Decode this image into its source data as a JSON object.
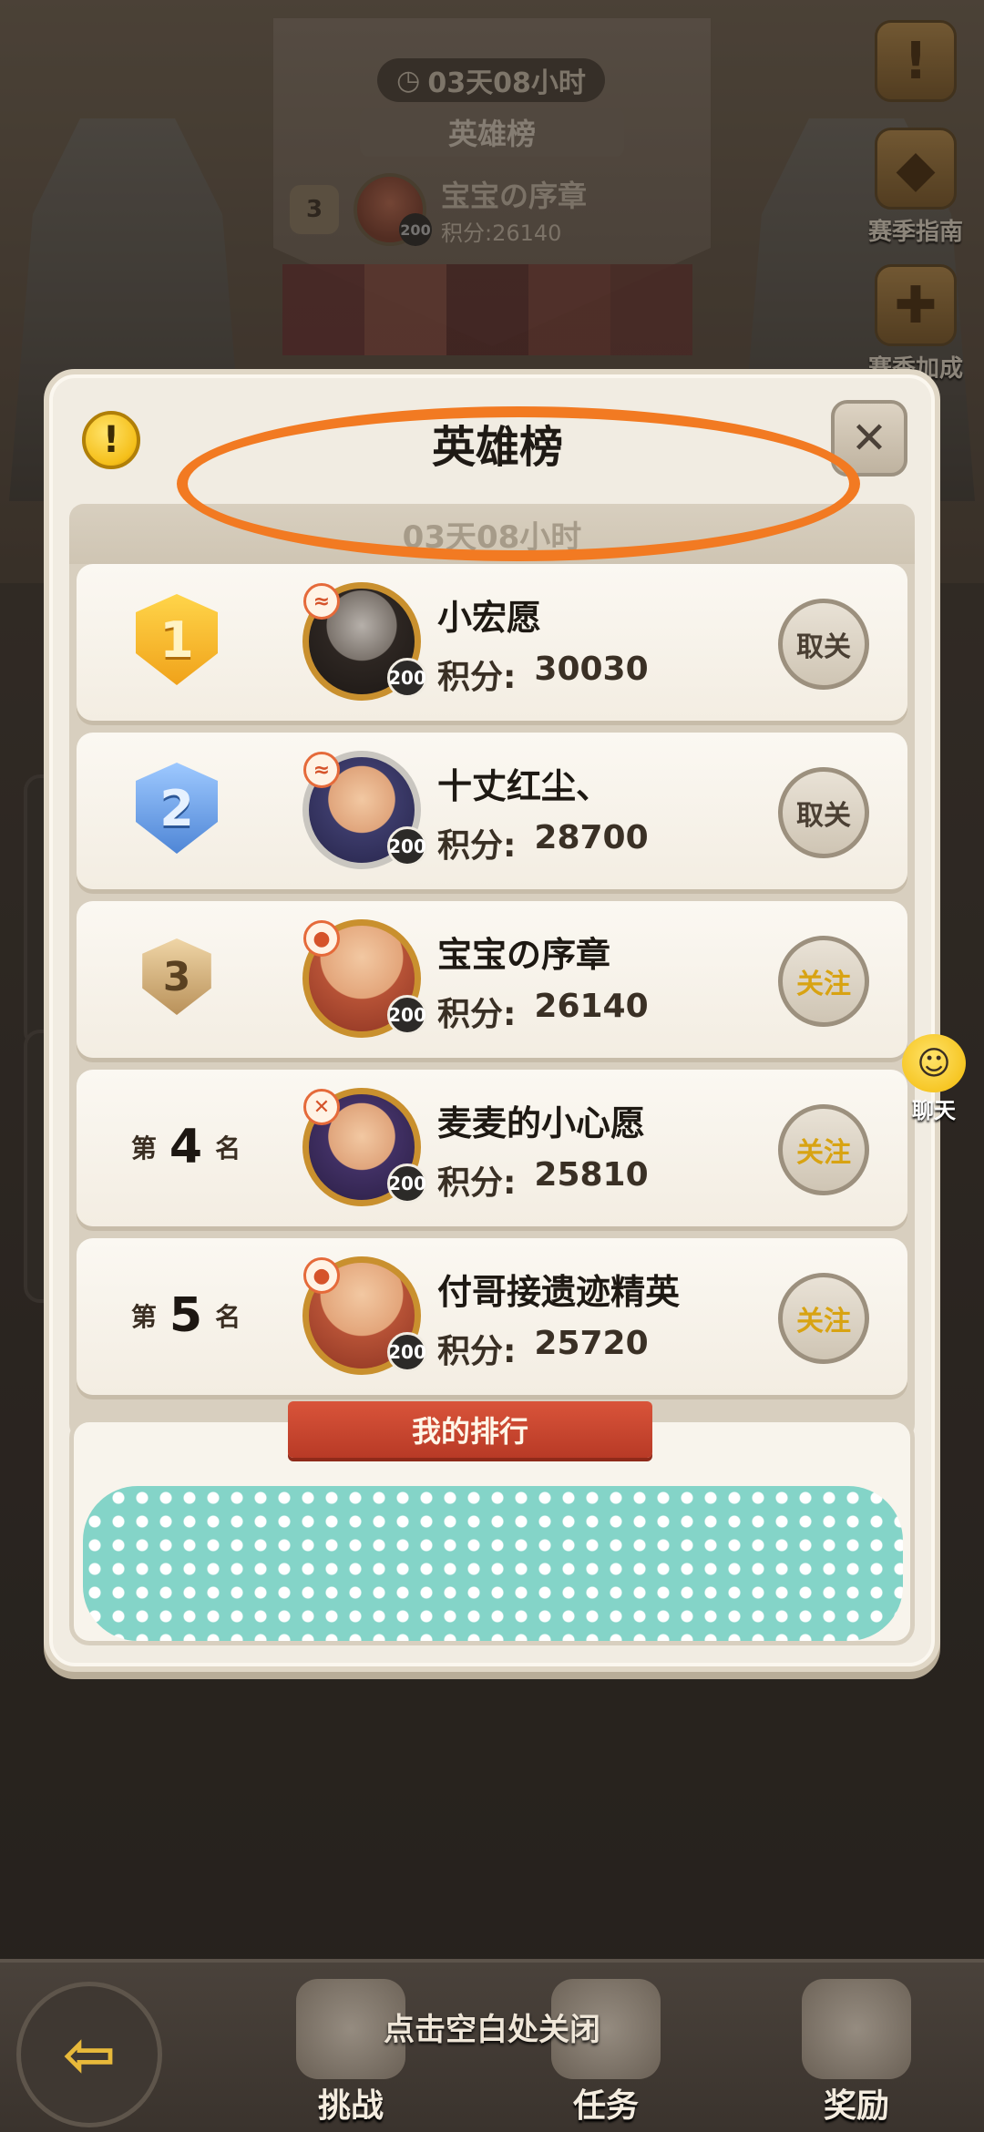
{
  "background": {
    "timer": "03天08小时",
    "title": "英雄榜",
    "entry": {
      "rank": "3",
      "level": "200",
      "name": "宝宝の序章",
      "score": "积分:26140"
    },
    "side_icons": [
      {
        "icon": "warning-icon",
        "label": ""
      },
      {
        "icon": "treasure-icon",
        "label": "赛季指南"
      },
      {
        "icon": "bonus-icon",
        "label": "赛季加成"
      }
    ]
  },
  "modal": {
    "title": "英雄榜",
    "timer": "03天08小时",
    "info_icon": "!",
    "close_icon": "✕",
    "score_label": "积分:",
    "rows": [
      {
        "rank": "1",
        "rank_type": "gold-badge",
        "name": "小宏愿",
        "score": "30030",
        "level": "200",
        "button": "取关"
      },
      {
        "rank": "2",
        "rank_type": "silver-badge",
        "name": "十丈红尘、",
        "score": "28700",
        "level": "200",
        "button": "取关"
      },
      {
        "rank": "3",
        "rank_type": "bronze-badge",
        "name": "宝宝の序章",
        "score": "26140",
        "level": "200",
        "button": "关注"
      },
      {
        "rank_prefix": "第",
        "rank": "4",
        "rank_suffix": "名",
        "name": "麦麦的小心愿",
        "score": "25810",
        "level": "200",
        "button": "关注"
      },
      {
        "rank_prefix": "第",
        "rank": "5",
        "rank_suffix": "名",
        "name": "付哥接遗迹精英",
        "score": "25720",
        "level": "200",
        "button": "关注"
      }
    ],
    "my_rank_label": "我的排行"
  },
  "chat": {
    "label": "聊天"
  },
  "bottom": {
    "close_hint": "点击空白处关闭",
    "nav": [
      {
        "label": "挑战",
        "icon": "target-icon"
      },
      {
        "label": "任务",
        "icon": "scroll-icon"
      },
      {
        "label": "奖励",
        "icon": "gift-icon"
      }
    ]
  },
  "colors": {
    "annotation": "#f27a22",
    "ribbon": "#c9442e",
    "follow_text": "#d8a312"
  }
}
